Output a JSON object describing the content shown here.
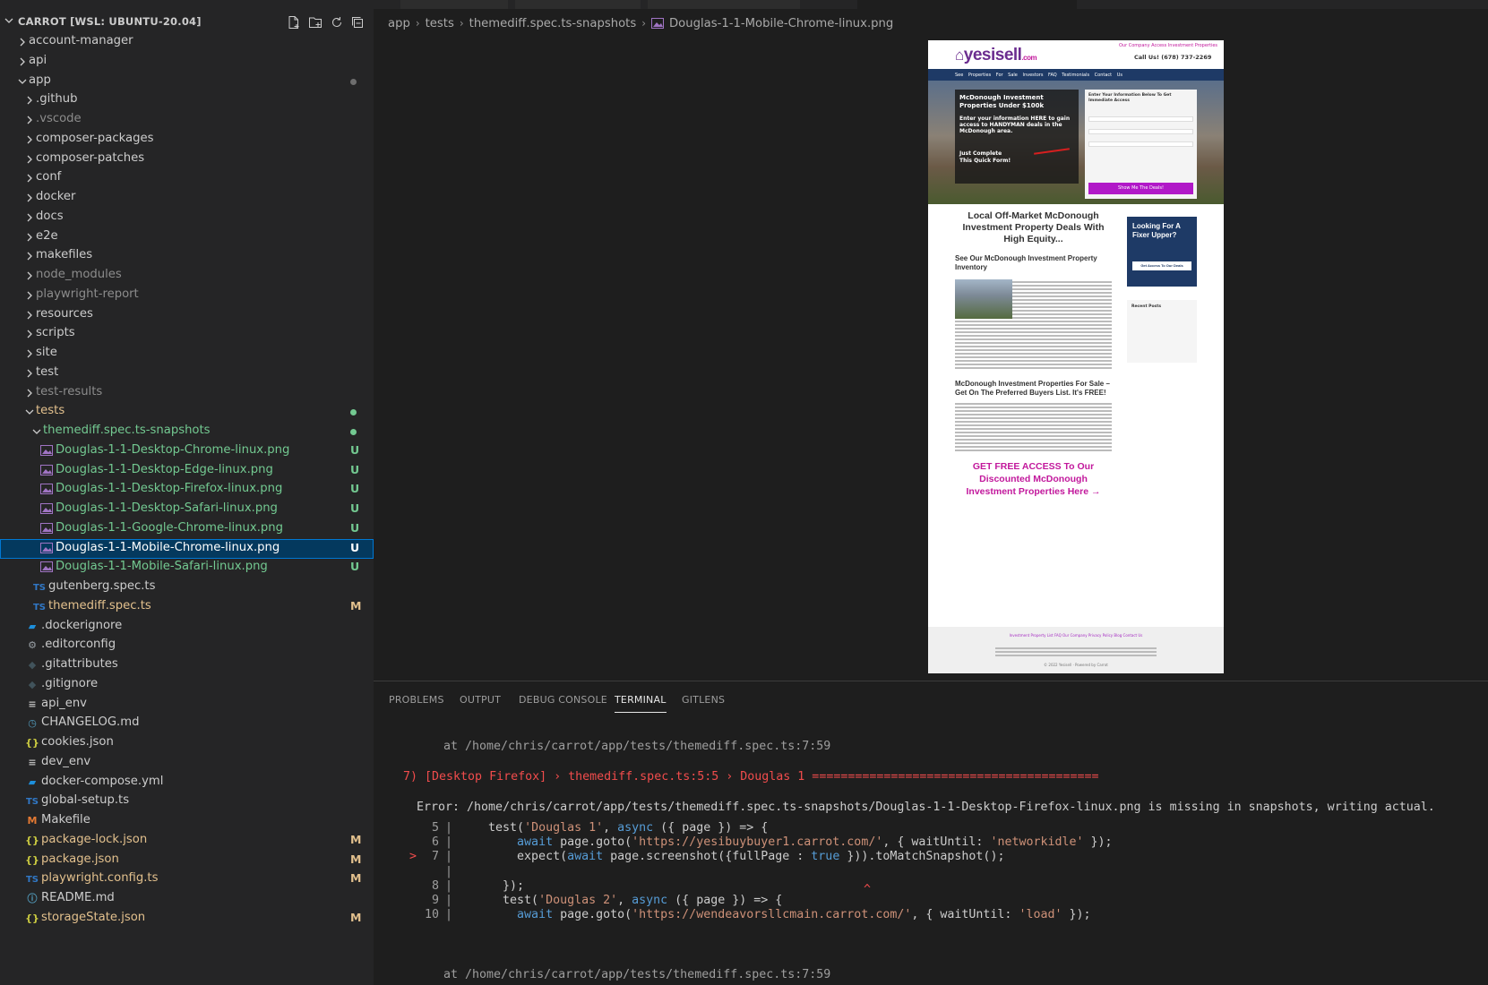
{
  "window": {
    "title": "Douglas-1-1-Mobile-Chrome-linux.png"
  },
  "explorer": {
    "title": "CARROT [WSL: UBUNTU-20.04]",
    "actions": [
      "new-file-icon",
      "new-folder-icon",
      "refresh-icon",
      "collapse-all-icon"
    ],
    "rows": [
      {
        "label": "account-manager",
        "kind": "folder",
        "expanded": false,
        "depth": 0,
        "color": "#cccccc",
        "badge": "",
        "dot": ""
      },
      {
        "label": "api",
        "kind": "folder",
        "expanded": false,
        "depth": 0,
        "color": "#cccccc",
        "badge": "",
        "dot": ""
      },
      {
        "label": "app",
        "kind": "folder",
        "expanded": true,
        "depth": 0,
        "color": "#cccccc",
        "badge": "",
        "dot": "#6e6e6e"
      },
      {
        "label": ".github",
        "kind": "folder",
        "expanded": false,
        "depth": 1,
        "color": "#cccccc",
        "badge": "",
        "dot": ""
      },
      {
        "label": ".vscode",
        "kind": "folder",
        "expanded": false,
        "depth": 1,
        "color": "#8c8c8c",
        "badge": "",
        "dot": ""
      },
      {
        "label": "composer-packages",
        "kind": "folder",
        "expanded": false,
        "depth": 1,
        "color": "#cccccc",
        "badge": "",
        "dot": ""
      },
      {
        "label": "composer-patches",
        "kind": "folder",
        "expanded": false,
        "depth": 1,
        "color": "#cccccc",
        "badge": "",
        "dot": ""
      },
      {
        "label": "conf",
        "kind": "folder",
        "expanded": false,
        "depth": 1,
        "color": "#cccccc",
        "badge": "",
        "dot": ""
      },
      {
        "label": "docker",
        "kind": "folder",
        "expanded": false,
        "depth": 1,
        "color": "#cccccc",
        "badge": "",
        "dot": ""
      },
      {
        "label": "docs",
        "kind": "folder",
        "expanded": false,
        "depth": 1,
        "color": "#cccccc",
        "badge": "",
        "dot": ""
      },
      {
        "label": "e2e",
        "kind": "folder",
        "expanded": false,
        "depth": 1,
        "color": "#cccccc",
        "badge": "",
        "dot": ""
      },
      {
        "label": "makefiles",
        "kind": "folder",
        "expanded": false,
        "depth": 1,
        "color": "#cccccc",
        "badge": "",
        "dot": ""
      },
      {
        "label": "node_modules",
        "kind": "folder",
        "expanded": false,
        "depth": 1,
        "color": "#8c8c8c",
        "badge": "",
        "dot": ""
      },
      {
        "label": "playwright-report",
        "kind": "folder",
        "expanded": false,
        "depth": 1,
        "color": "#8c8c8c",
        "badge": "",
        "dot": ""
      },
      {
        "label": "resources",
        "kind": "folder",
        "expanded": false,
        "depth": 1,
        "color": "#cccccc",
        "badge": "",
        "dot": ""
      },
      {
        "label": "scripts",
        "kind": "folder",
        "expanded": false,
        "depth": 1,
        "color": "#cccccc",
        "badge": "",
        "dot": ""
      },
      {
        "label": "site",
        "kind": "folder",
        "expanded": false,
        "depth": 1,
        "color": "#cccccc",
        "badge": "",
        "dot": ""
      },
      {
        "label": "test",
        "kind": "folder",
        "expanded": false,
        "depth": 1,
        "color": "#cccccc",
        "badge": "",
        "dot": ""
      },
      {
        "label": "test-results",
        "kind": "folder",
        "expanded": false,
        "depth": 1,
        "color": "#8c8c8c",
        "badge": "",
        "dot": ""
      },
      {
        "label": "tests",
        "kind": "folder",
        "expanded": true,
        "depth": 1,
        "color": "#e2c08d",
        "badge": "",
        "dot": "#73c991"
      },
      {
        "label": "themediff.spec.ts-snapshots",
        "kind": "folder",
        "expanded": true,
        "depth": 2,
        "color": "#73c991",
        "badge": "",
        "dot": "#73c991"
      },
      {
        "label": "Douglas-1-1-Desktop-Chrome-linux.png",
        "kind": "image",
        "depth": 3,
        "color": "#73c991",
        "badge": "U",
        "dot": ""
      },
      {
        "label": "Douglas-1-1-Desktop-Edge-linux.png",
        "kind": "image",
        "depth": 3,
        "color": "#73c991",
        "badge": "U",
        "dot": ""
      },
      {
        "label": "Douglas-1-1-Desktop-Firefox-linux.png",
        "kind": "image",
        "depth": 3,
        "color": "#73c991",
        "badge": "U",
        "dot": ""
      },
      {
        "label": "Douglas-1-1-Desktop-Safari-linux.png",
        "kind": "image",
        "depth": 3,
        "color": "#73c991",
        "badge": "U",
        "dot": ""
      },
      {
        "label": "Douglas-1-1-Google-Chrome-linux.png",
        "kind": "image",
        "depth": 3,
        "color": "#73c991",
        "badge": "U",
        "dot": ""
      },
      {
        "label": "Douglas-1-1-Mobile-Chrome-linux.png",
        "kind": "image",
        "depth": 3,
        "color": "#ffffff",
        "badge": "U",
        "dot": "",
        "selected": true
      },
      {
        "label": "Douglas-1-1-Mobile-Safari-linux.png",
        "kind": "image",
        "depth": 3,
        "color": "#73c991",
        "badge": "U",
        "dot": ""
      },
      {
        "label": "gutenberg.spec.ts",
        "kind": "ts",
        "depth": 2,
        "color": "#cccccc",
        "badge": "",
        "dot": ""
      },
      {
        "label": "themediff.spec.ts",
        "kind": "ts",
        "depth": 2,
        "color": "#e2c08d",
        "badge": "M",
        "dot": ""
      },
      {
        "label": ".dockerignore",
        "kind": "docker",
        "depth": 1,
        "color": "#cccccc",
        "badge": "",
        "dot": ""
      },
      {
        "label": ".editorconfig",
        "kind": "gear",
        "depth": 1,
        "color": "#cccccc",
        "badge": "",
        "dot": ""
      },
      {
        "label": ".gitattributes",
        "kind": "git",
        "depth": 1,
        "color": "#cccccc",
        "badge": "",
        "dot": ""
      },
      {
        "label": ".gitignore",
        "kind": "git",
        "depth": 1,
        "color": "#cccccc",
        "badge": "",
        "dot": ""
      },
      {
        "label": "api_env",
        "kind": "lines",
        "depth": 1,
        "color": "#cccccc",
        "badge": "",
        "dot": ""
      },
      {
        "label": "CHANGELOG.md",
        "kind": "clock",
        "depth": 1,
        "color": "#cccccc",
        "badge": "",
        "dot": ""
      },
      {
        "label": "cookies.json",
        "kind": "json",
        "depth": 1,
        "color": "#cccccc",
        "badge": "",
        "dot": ""
      },
      {
        "label": "dev_env",
        "kind": "lines",
        "depth": 1,
        "color": "#cccccc",
        "badge": "",
        "dot": ""
      },
      {
        "label": "docker-compose.yml",
        "kind": "docker",
        "depth": 1,
        "color": "#cccccc",
        "badge": "",
        "dot": ""
      },
      {
        "label": "global-setup.ts",
        "kind": "ts",
        "depth": 1,
        "color": "#cccccc",
        "badge": "",
        "dot": ""
      },
      {
        "label": "Makefile",
        "kind": "make",
        "depth": 1,
        "color": "#cccccc",
        "badge": "",
        "dot": ""
      },
      {
        "label": "package-lock.json",
        "kind": "json",
        "depth": 1,
        "color": "#e2c08d",
        "badge": "M",
        "dot": ""
      },
      {
        "label": "package.json",
        "kind": "json",
        "depth": 1,
        "color": "#e2c08d",
        "badge": "M",
        "dot": ""
      },
      {
        "label": "playwright.config.ts",
        "kind": "ts",
        "depth": 1,
        "color": "#e2c08d",
        "badge": "M",
        "dot": ""
      },
      {
        "label": "README.md",
        "kind": "info",
        "depth": 1,
        "color": "#cccccc",
        "badge": "",
        "dot": ""
      },
      {
        "label": "storageState.json",
        "kind": "json",
        "depth": 1,
        "color": "#e2c08d",
        "badge": "M",
        "dot": ""
      }
    ]
  },
  "breadcrumb": [
    "app",
    "tests",
    "themediff.spec.ts-snapshots",
    "Douglas-1-1-Mobile-Chrome-linux.png"
  ],
  "preview_site": {
    "logo": "yesisell",
    "logo_suffix": ".com",
    "top_links": "Our Company   Access Investment Properties",
    "call": "Call Us! (678) 737-2269",
    "nav": "See Properties For Sale   Investors   FAQ   Testimonials   Contact Us",
    "hero_heading": "McDonough Investment Properties Under $100k",
    "hero_sub": "Enter your information HERE to gain access to HANDYMAN deals in the McDonough area.",
    "hero_form_title": "Enter Your Information Below To Get Immediate Access",
    "hero_cta": "Just Complete This Quick Form!",
    "hero_button": "Show Me The Deals!",
    "main_heading": "Local Off-Market McDonough Investment Property Deals With High Equity...",
    "inventory_heading": "See Our McDonough Investment Property Inventory",
    "section2_heading": "McDonough Investment Properties For Sale – Get On The Preferred Buyers List. It's FREE!",
    "cta_link": "GET FREE ACCESS To Our Discounted McDonough Investment Properties Here →",
    "side_heading": "Looking For A Fixer Upper?",
    "side_button": "Get Access To Our Deals",
    "recent_posts": "Recent Posts",
    "footer_links": "Investment Property List   FAQ   Our Company   Privacy Policy   Blog   Contact Us",
    "footer_copy": "© 2022 Yesisell · Powered by Carrot"
  },
  "panel": {
    "tabs": [
      "PROBLEMS",
      "OUTPUT",
      "DEBUG CONSOLE",
      "TERMINAL",
      "GITLENS"
    ],
    "active_tab": "TERMINAL"
  },
  "terminal": {
    "at1": "at /home/chris/carrot/app/tests/themediff.spec.ts:7:59",
    "fail_line": "7) [Desktop Firefox] › themediff.spec.ts:5:5 › Douglas 1 ========================================",
    "error_line": "Error: /home/chris/carrot/app/tests/themediff.spec.ts-snapshots/Douglas-1-1-Desktop-Firefox-linux.png is missing in snapshots, writing actual.",
    "code": [
      {
        "no": "5",
        "marker": "",
        "text": "    test('Douglas 1', async ({ page }) => {"
      },
      {
        "no": "6",
        "marker": "",
        "text": "        await page.goto('https://yesibuybuyer1.carrot.com/', { waitUntil: 'networkidle' });"
      },
      {
        "no": "7",
        "marker": ">",
        "text": "        expect(await page.screenshot({fullPage : true })).toMatchSnapshot();"
      },
      {
        "no": "",
        "marker": "",
        "text": ""
      },
      {
        "no": "8",
        "marker": "",
        "text": "      });"
      },
      {
        "no": "9",
        "marker": "",
        "text": "      test('Douglas 2', async ({ page }) => {"
      },
      {
        "no": "10",
        "marker": "",
        "text": "        await page.goto('https://wendeavorsllcmain.carrot.com/', { waitUntil: 'load' });"
      }
    ],
    "caret": "^",
    "at2": "at /home/chris/carrot/app/tests/themediff.spec.ts:7:59"
  }
}
